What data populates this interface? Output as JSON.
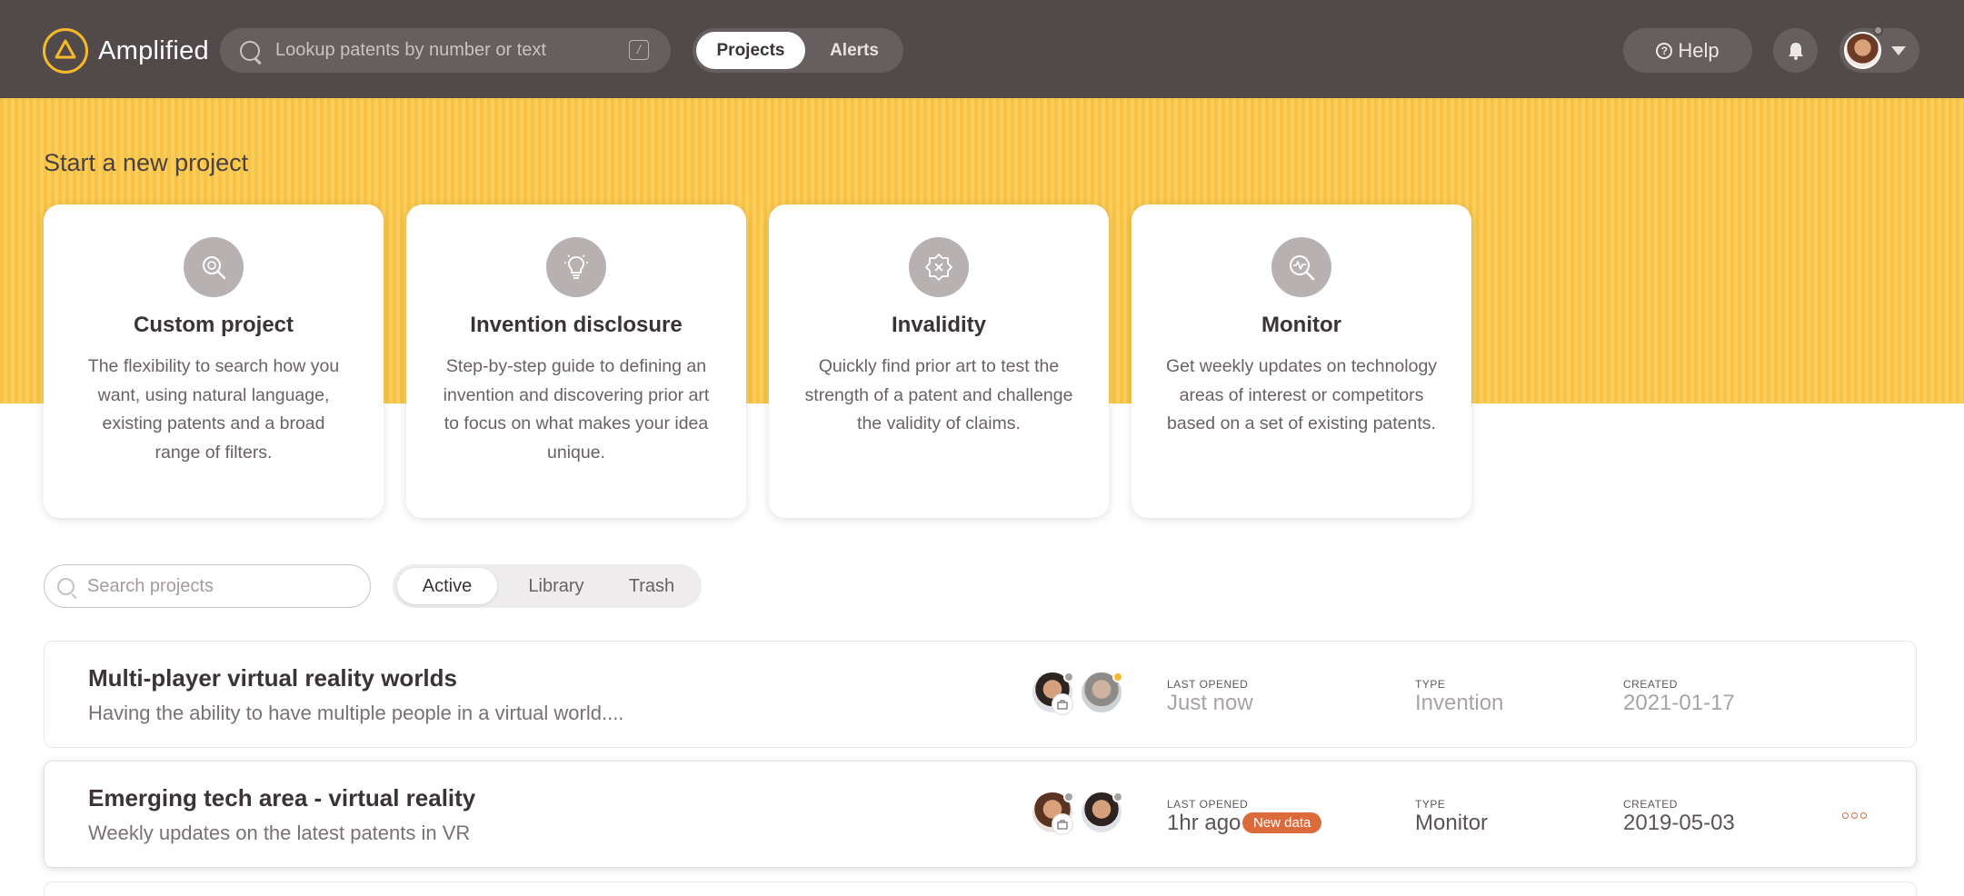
{
  "app": {
    "name": "Amplified",
    "search_placeholder": "Lookup patents by number or text",
    "shortcut_key": "/",
    "nav": [
      {
        "label": "Projects",
        "active": true
      },
      {
        "label": "Alerts",
        "active": false
      }
    ],
    "help_label": "Help"
  },
  "banner": {
    "title": "Start a new project",
    "cards": [
      {
        "icon": "search-gear-icon",
        "title": "Custom project",
        "description": "The flexibility to search how you want, using natural language, existing patents and a broad range of filters."
      },
      {
        "icon": "lightbulb-icon",
        "title": "Invention disclosure",
        "description": "Step-by-step guide to defining an invention and discovering prior art to focus on what makes your idea unique."
      },
      {
        "icon": "invalid-badge-icon",
        "title": "Invalidity",
        "description": "Quickly find prior art to test the strength of a patent and challenge the validity of claims."
      },
      {
        "icon": "monitor-search-icon",
        "title": "Monitor",
        "description": "Get weekly updates on technology areas of interest or competitors based on a set of existing patents."
      }
    ]
  },
  "projects": {
    "search_placeholder": "Search projects",
    "tabs": [
      {
        "label": "Active",
        "active": true
      },
      {
        "label": "Library",
        "active": false
      },
      {
        "label": "Trash",
        "active": false
      }
    ],
    "labels": {
      "last_opened": "LAST OPENED",
      "type": "TYPE",
      "created": "CREATED"
    },
    "rows": [
      {
        "title": "Multi-player virtual reality worlds",
        "subtitle": "Having the ability to have multiple people in a virtual world....",
        "last_opened": "Just now",
        "type": "Invention",
        "created": "2021-01-17",
        "badge": ""
      },
      {
        "title": "Emerging tech area - virtual reality",
        "subtitle": "Weekly updates on the latest patents in VR",
        "last_opened": "1hr ago",
        "type": "Monitor",
        "created": "2019-05-03",
        "badge": "New data"
      }
    ]
  },
  "colors": {
    "topbar": "#524a4a",
    "banner": "#f7c245",
    "accent": "#dc6b3c",
    "logo": "#f7b92a"
  }
}
